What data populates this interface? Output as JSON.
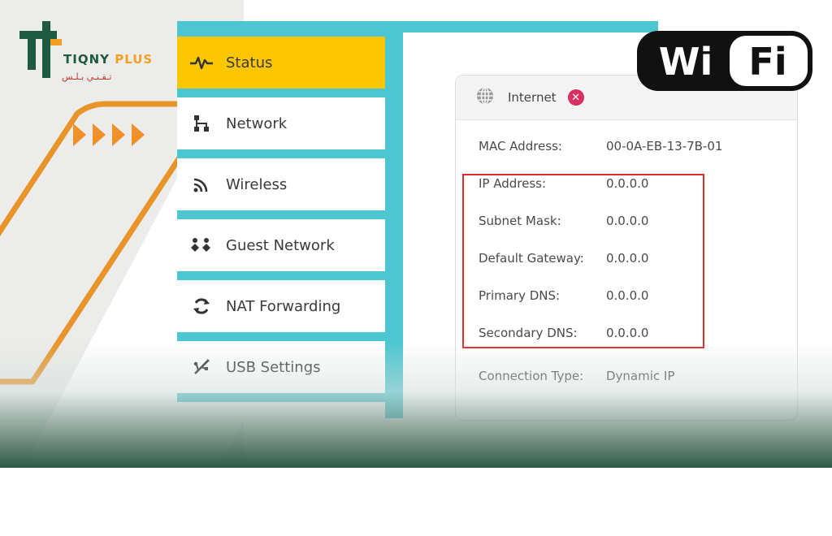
{
  "brand": {
    "name_part1": "TIQNY",
    "name_part2": "PLUS",
    "name_arabic": "تـقـنـي بـلـس"
  },
  "badge": {
    "text_left": "Wi",
    "text_right": "Fi"
  },
  "sidebar": {
    "items": [
      {
        "label": "Status",
        "icon": "status-pulse-icon",
        "active": true
      },
      {
        "label": "Network",
        "icon": "network-icon",
        "active": false
      },
      {
        "label": "Wireless",
        "icon": "wireless-icon",
        "active": false
      },
      {
        "label": "Guest Network",
        "icon": "guest-network-icon",
        "active": false
      },
      {
        "label": "NAT Forwarding",
        "icon": "nat-forwarding-icon",
        "active": false
      },
      {
        "label": "USB Settings",
        "icon": "usb-icon",
        "active": false
      }
    ]
  },
  "internet_panel": {
    "title": "Internet",
    "status_icon": "disconnected-x-icon",
    "rows": [
      {
        "label": "MAC Address:",
        "value": "00-0A-EB-13-7B-01"
      },
      {
        "label": "IP Address:",
        "value": "0.0.0.0"
      },
      {
        "label": "Subnet Mask:",
        "value": "0.0.0.0"
      },
      {
        "label": "Default Gateway:",
        "value": "0.0.0.0"
      },
      {
        "label": "Primary DNS:",
        "value": "0.0.0.0"
      },
      {
        "label": "Secondary DNS:",
        "value": "0.0.0.0"
      },
      {
        "label": "Connection Type:",
        "value": "Dynamic IP"
      }
    ]
  },
  "colors": {
    "accent_cyan": "#4cc6d1",
    "active_yellow": "#fdc700",
    "highlight_red": "#dd2a2a",
    "brand_green": "#1e5a43",
    "brand_orange": "#f2a023"
  }
}
